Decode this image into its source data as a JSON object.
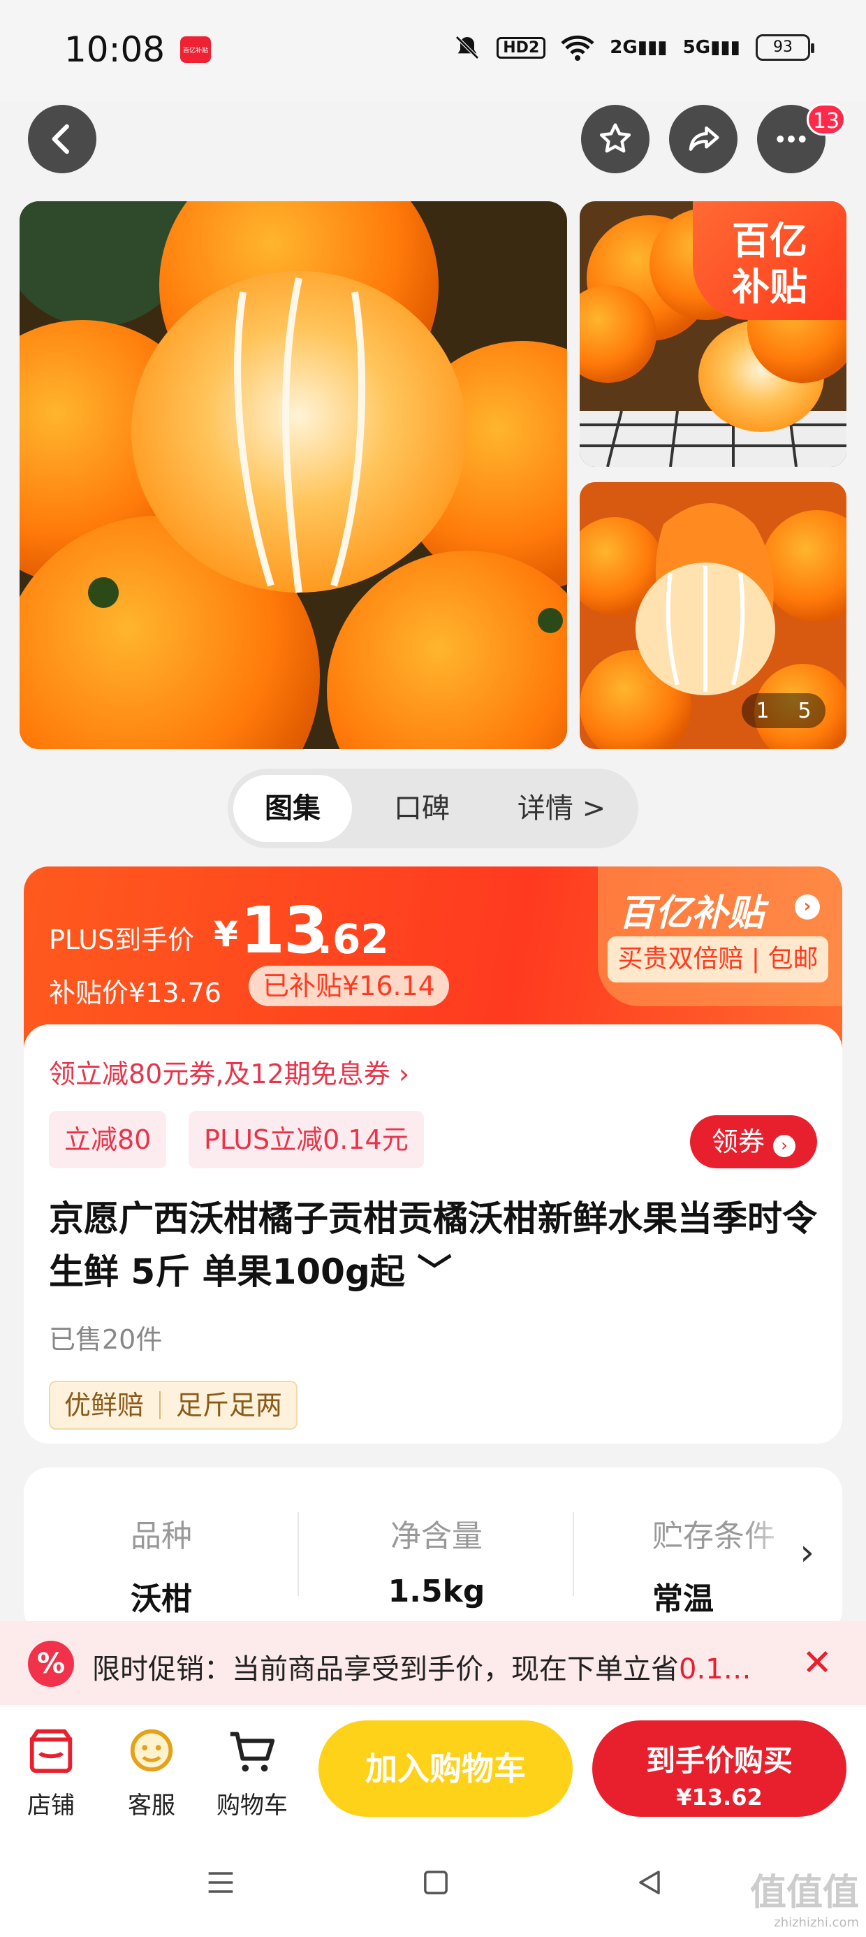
{
  "status_bar": {
    "time": "10:08",
    "app_badge": "百亿补贴",
    "hd": "HD2",
    "net1": "2G",
    "net2": "5G",
    "battery": "93"
  },
  "nav": {
    "notification_count": "13"
  },
  "gallery": {
    "subsidy_tag_line1": "百亿",
    "subsidy_tag_line2": "补贴",
    "pager_current": "1",
    "pager_total": "5"
  },
  "tabs": [
    {
      "label": "图集"
    },
    {
      "label": "口碑"
    },
    {
      "label": "详情 >"
    }
  ],
  "price": {
    "plus_label": "PLUS到手价",
    "currency": "¥",
    "integer": "13",
    "decimal": ".62",
    "subsidy_price": "补贴价¥13.76",
    "subsidized": "已补贴¥16.14",
    "brand": "百亿补贴",
    "brand_tagline": "买贵双倍赔 | 包邮"
  },
  "coupons": {
    "link_text": "领立减80元券,及12期免息券 ›",
    "tag1": "立减80",
    "tag2": "PLUS立减0.14元",
    "get_button": "领券"
  },
  "product": {
    "title": "京愿广西沃柑橘子贡柑贡橘沃柑新鲜水果当季时令生鲜 5斤 单果100g起 ﹀",
    "sold": "已售20件",
    "guarantee1": "优鲜赔",
    "guarantee2": "足斤足两"
  },
  "specs": [
    {
      "key": "品种",
      "value": "沃柑"
    },
    {
      "key": "净含量",
      "value": "1.5kg"
    },
    {
      "key": "贮存条件",
      "value": "常温"
    }
  ],
  "promo": {
    "icon": "%",
    "text": "限时促销：当前商品享受到手价，现在下单立省",
    "highlight": "0.1…"
  },
  "bottom_bar": {
    "shop": "店铺",
    "service": "客服",
    "cart": "购物车",
    "add_to_cart": "加入购物车",
    "buy_line1": "到手价购买",
    "buy_line2": "¥13.62"
  },
  "watermark": {
    "main": "值值值",
    "sub": "zhizhizhi.com"
  },
  "colors": {
    "accent": "#e8202e",
    "orange": "#ff5a1e",
    "yellow": "#ffd21a"
  }
}
